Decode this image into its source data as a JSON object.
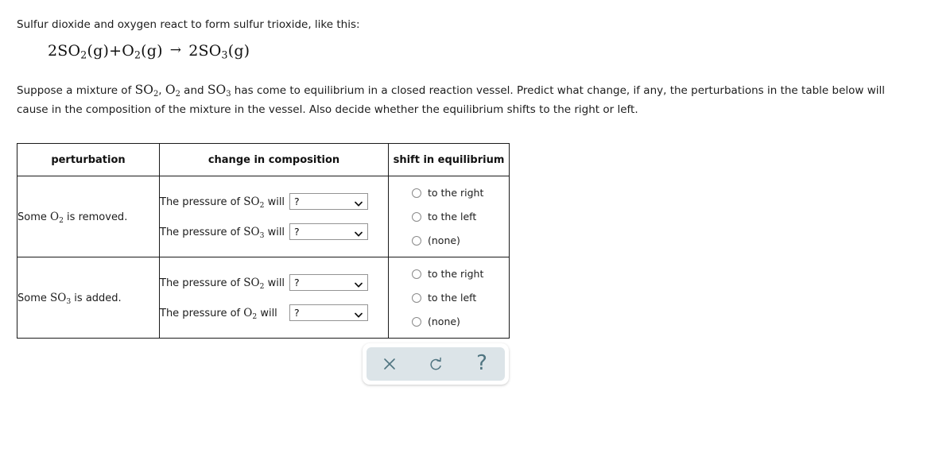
{
  "intro": {
    "lead": "Sulfur dioxide and oxygen react to form sulfur trioxide, like this:",
    "equation": {
      "left_coef_1": "2",
      "left_formula_1": "SO",
      "left_sub_1": "2",
      "left_state_1": "(g)",
      "plus": "+",
      "left_formula_2": "O",
      "left_sub_2": "2",
      "left_state_2": "(g)",
      "arrow": "→",
      "right_coef": "2",
      "right_formula": "SO",
      "right_sub": "3",
      "right_state": "(g)",
      "plain_text": "2SO2(g)+O2(g) → 2SO3(g)"
    },
    "paragraph_part_1": "Suppose a mixture of ",
    "paragraph_chem_1": "SO",
    "paragraph_chem_1_sub": "2",
    "paragraph_part_2": ", ",
    "paragraph_chem_2": "O",
    "paragraph_chem_2_sub": "2",
    "paragraph_part_3": " and ",
    "paragraph_chem_3": "SO",
    "paragraph_chem_3_sub": "3",
    "paragraph_part_4": " has come to equilibrium in a closed reaction vessel. Predict what change, if any, the perturbations in the table below will cause in the composition of the mixture in the vessel. Also decide whether the equilibrium shifts to the right or left."
  },
  "table": {
    "headers": {
      "perturbation": "perturbation",
      "change": "change in composition",
      "shift": "shift in equilibrium"
    },
    "rows": [
      {
        "perturbation_pre": "Some ",
        "perturbation_chem": "O",
        "perturbation_sub": "2",
        "perturbation_post": " is removed.",
        "perturbation_text": "Some O2 is removed.",
        "changes": [
          {
            "label_pre": "The pressure of ",
            "label_chem": "SO",
            "label_sub": "2",
            "label_post": " will",
            "label_text": "The pressure of SO2 will",
            "select_value": "?"
          },
          {
            "label_pre": "The pressure of ",
            "label_chem": "SO",
            "label_sub": "3",
            "label_post": " will",
            "label_text": "The pressure of SO3 will",
            "select_value": "?"
          }
        ],
        "shift_options": [
          {
            "label": "to the right",
            "selected": false
          },
          {
            "label": "to the left",
            "selected": false
          },
          {
            "label": "(none)",
            "selected": false
          }
        ]
      },
      {
        "perturbation_pre": "Some ",
        "perturbation_chem": "SO",
        "perturbation_sub": "3",
        "perturbation_post": " is added.",
        "perturbation_text": "Some SO3 is added.",
        "changes": [
          {
            "label_pre": "The pressure of ",
            "label_chem": "SO",
            "label_sub": "2",
            "label_post": " will",
            "label_text": "The pressure of SO2 will",
            "select_value": "?"
          },
          {
            "label_pre": "The pressure of ",
            "label_chem": "O",
            "label_sub": "2",
            "label_post": " will",
            "label_text": "The pressure of O2 will",
            "select_value": "?"
          }
        ],
        "shift_options": [
          {
            "label": "to the right",
            "selected": false
          },
          {
            "label": "to the left",
            "selected": false
          },
          {
            "label": "(none)",
            "selected": false
          }
        ]
      }
    ]
  },
  "toolbar": {
    "background": "#dce4e8",
    "icon_color": "#4f7480",
    "buttons": [
      {
        "name": "close-icon",
        "glyph": "×",
        "tooltip": "Clear"
      },
      {
        "name": "undo-icon",
        "glyph": "↺",
        "tooltip": "Reset"
      },
      {
        "name": "help-icon",
        "glyph": "?",
        "tooltip": "Help"
      }
    ]
  }
}
